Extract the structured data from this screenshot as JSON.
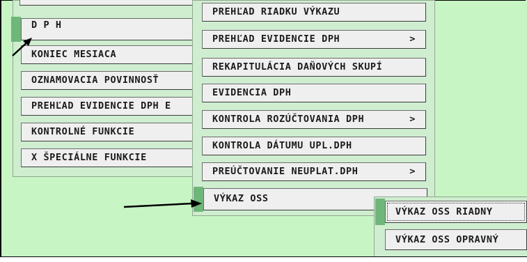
{
  "menu_level1": {
    "items": [
      {
        "label": "D P H",
        "arrow": ""
      },
      {
        "label": "KONIEC MESIACA",
        "arrow": ""
      },
      {
        "label": "OZNAMOVACIA POVINNOSŤ",
        "arrow": ""
      },
      {
        "label": "PREHĽAD EVIDENCIE DPH E",
        "arrow": ""
      },
      {
        "label": "KONTROLNÉ FUNKCIE",
        "arrow": ""
      },
      {
        "label": "X ŠPECIÁLNE FUNKCIE",
        "arrow": ""
      }
    ]
  },
  "menu_level2": {
    "items": [
      {
        "label": "PREHĽAD RIADKU VÝKAZU",
        "arrow": ""
      },
      {
        "label": "PREHĽAD EVIDENCIE DPH",
        "arrow": ">"
      },
      {
        "label": "REKAPITULÁCIA DAŇOVÝCH SKUPÍ",
        "arrow": ""
      },
      {
        "label": "EVIDENCIA DPH",
        "arrow": ""
      },
      {
        "label": "KONTROLA ROZÚČTOVANIA DPH",
        "arrow": ">"
      },
      {
        "label": "KONTROLA DÁTUMU UPL.DPH",
        "arrow": ""
      },
      {
        "label": "PREÚČTOVANIE NEUPLAT.DPH",
        "arrow": ">"
      },
      {
        "label": "VÝKAZ OSS",
        "arrow": ""
      }
    ]
  },
  "menu_level3": {
    "items": [
      {
        "label": "VÝKAZ OSS RIADNY"
      },
      {
        "label": "VÝKAZ OSS OPRAVNÝ"
      }
    ]
  },
  "colors": {
    "background": "#c8f5c4",
    "item": "#efefef",
    "selection_strip": "#6fb67a"
  }
}
